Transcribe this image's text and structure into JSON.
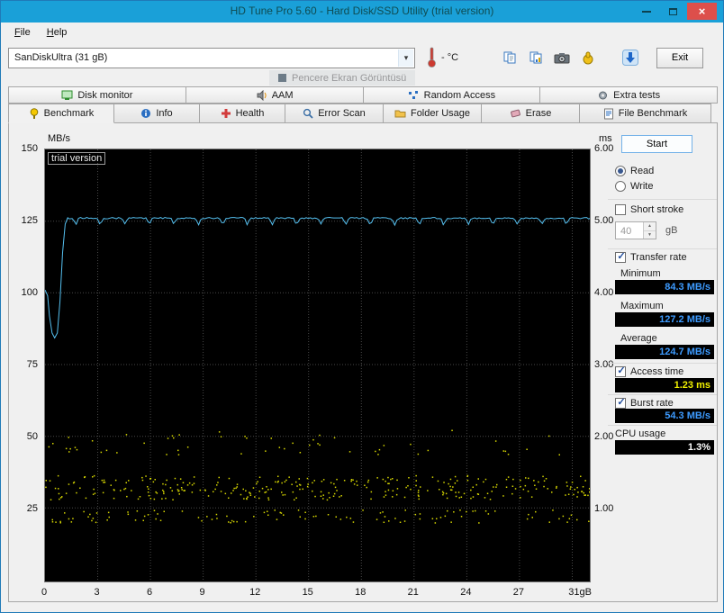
{
  "window": {
    "title": "HD Tune Pro 5.60 - Hard Disk/SSD Utility (trial version)"
  },
  "menu": {
    "file": "File",
    "help": "Help"
  },
  "toolbar": {
    "drive": "SanDiskUltra (31 gB)",
    "temperature": "-  °C",
    "buttons": [
      {
        "name": "copy-text-icon"
      },
      {
        "name": "copy-image-icon"
      },
      {
        "name": "screenshot-camera-icon"
      },
      {
        "name": "hand-icon"
      },
      {
        "name": "save-download-icon"
      }
    ],
    "exit_label": "Exit"
  },
  "tooltip": {
    "text": "Pencere Ekran Görüntüsü"
  },
  "tabs_top": [
    {
      "label": "Disk monitor"
    },
    {
      "label": "AAM"
    },
    {
      "label": "Random Access"
    },
    {
      "label": "Extra tests"
    }
  ],
  "tabs_main": [
    {
      "label": "Benchmark",
      "active": true
    },
    {
      "label": "Info"
    },
    {
      "label": "Health"
    },
    {
      "label": "Error Scan"
    },
    {
      "label": "Folder Usage"
    },
    {
      "label": "Erase"
    },
    {
      "label": "File Benchmark"
    }
  ],
  "panel": {
    "start_label": "Start",
    "read_label": "Read",
    "write_label": "Write",
    "read_selected": true,
    "short_stroke": {
      "label": "Short stroke",
      "checked": false,
      "value": "40",
      "unit": "gB"
    },
    "transfer_rate": {
      "label": "Transfer rate",
      "checked": true,
      "minimum_label": "Minimum",
      "minimum_value": "84.3 MB/s",
      "maximum_label": "Maximum",
      "maximum_value": "127.2 MB/s",
      "average_label": "Average",
      "average_value": "124.7 MB/s"
    },
    "access_time": {
      "label": "Access time",
      "checked": true,
      "value": "1.23 ms"
    },
    "burst_rate": {
      "label": "Burst rate",
      "checked": true,
      "value": "54.3 MB/s"
    },
    "cpu_usage": {
      "label": "CPU usage",
      "value": "1.3%"
    }
  },
  "chart_data": {
    "type": "line",
    "watermark": "trial version",
    "left_axis": {
      "label": "MB/s",
      "max": 150,
      "ticks": [
        "150",
        "125",
        "100",
        "75",
        "50",
        "25"
      ]
    },
    "right_axis": {
      "label": "ms",
      "max": 6,
      "ticks": [
        "6.00",
        "5.00",
        "4.00",
        "3.00",
        "2.00",
        "1.00"
      ]
    },
    "x_axis": {
      "max": 31,
      "tick_step": 3,
      "ticks": [
        "0",
        "3",
        "6",
        "9",
        "12",
        "15",
        "18",
        "21",
        "24",
        "27"
      ],
      "end_label": "31gB",
      "unit": "gB"
    },
    "series": [
      {
        "name": "transfer_rate",
        "type": "line",
        "axis": "left",
        "unit": "MB/s",
        "color": "#55c0f0",
        "head_points": [
          [
            0,
            101
          ],
          [
            0.15,
            99
          ],
          [
            0.25,
            92
          ],
          [
            0.4,
            86
          ],
          [
            0.55,
            84.3
          ],
          [
            0.7,
            86
          ],
          [
            0.85,
            97
          ],
          [
            1.0,
            114
          ],
          [
            1.15,
            124
          ],
          [
            1.3,
            126.3
          ]
        ],
        "flat": {
          "from": 1.3,
          "to": 31,
          "base": 126.3,
          "notch_depth": 2.2,
          "notch_freq": 4.5
        }
      },
      {
        "name": "access_time",
        "type": "scatter",
        "axis": "right",
        "unit": "ms",
        "color": "#d6d600",
        "bands": [
          {
            "ms_min": 1.12,
            "ms_max": 1.46,
            "count": 320
          },
          {
            "ms_min": 0.8,
            "ms_max": 0.98,
            "count": 110
          },
          {
            "ms_min": 1.75,
            "ms_max": 2.1,
            "count": 55
          }
        ]
      }
    ],
    "stats": {
      "minimum_mb_s": 84.3,
      "maximum_mb_s": 127.2,
      "average_mb_s": 124.7,
      "access_time_ms": 1.23,
      "burst_rate_mb_s": 54.3,
      "cpu_usage_pct": 1.3
    }
  }
}
